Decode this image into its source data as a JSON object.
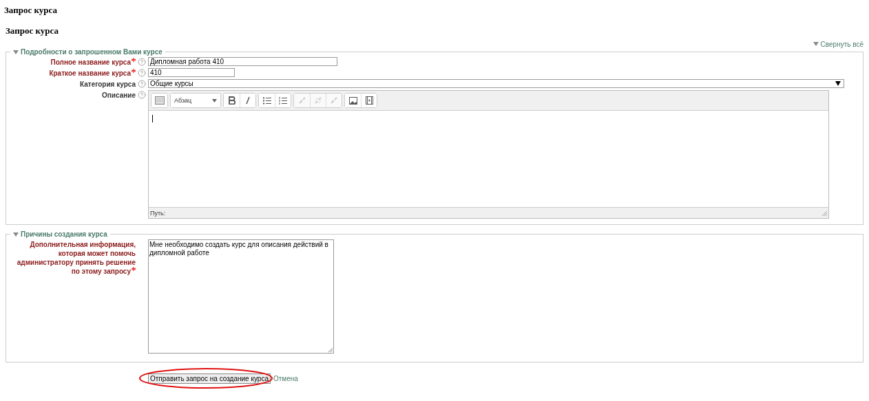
{
  "page_title": "Запрос курса",
  "form_title": "Запрос курса",
  "collapse_all": "Свернуть всё",
  "sections": [
    {
      "legend": "Подробности о запрошенном Вами курсе",
      "expanded": true,
      "fields": [
        {
          "kind": "longtext",
          "label": "Полное название курса",
          "required": true,
          "value": "Дипломная работа 410"
        },
        {
          "kind": "shorttext",
          "label": "Краткое название курса",
          "required": true,
          "value": "410"
        },
        {
          "kind": "select",
          "label": "Категория курса",
          "required": false,
          "value": "Общие курсы"
        },
        {
          "kind": "editor",
          "label": "Описание",
          "required": false,
          "paragraph_format": "Абзац",
          "path_label": "Путь:",
          "toolbar": [
            [
              {
                "kind": "toggle",
                "disabled": false
              }
            ],
            [
              {
                "kind": "format",
                "disabled": false
              }
            ],
            [
              {
                "kind": "bold",
                "disabled": false
              },
              {
                "kind": "italic",
                "disabled": false
              }
            ],
            [
              {
                "kind": "bullets",
                "disabled": false
              },
              {
                "kind": "numbers",
                "disabled": false
              }
            ],
            [
              {
                "kind": "link",
                "disabled": true
              },
              {
                "kind": "unlink",
                "disabled": true
              },
              {
                "kind": "link",
                "disabled": true
              }
            ],
            [
              {
                "kind": "image",
                "disabled": false
              },
              {
                "kind": "media",
                "disabled": false
              }
            ]
          ]
        }
      ]
    },
    {
      "legend": "Причины создания курса",
      "expanded": true,
      "fields": [
        {
          "kind": "textarea",
          "label": "Дополнительная информация, которая может помочь администратору принять решение по этому запросу",
          "required": true,
          "value": "Мне необходимо создать курс для описания действий в дипломной работе"
        }
      ]
    }
  ],
  "submit": {
    "label": "Отправить запрос на создание курса",
    "circled": true
  },
  "cancel": "Отмена"
}
